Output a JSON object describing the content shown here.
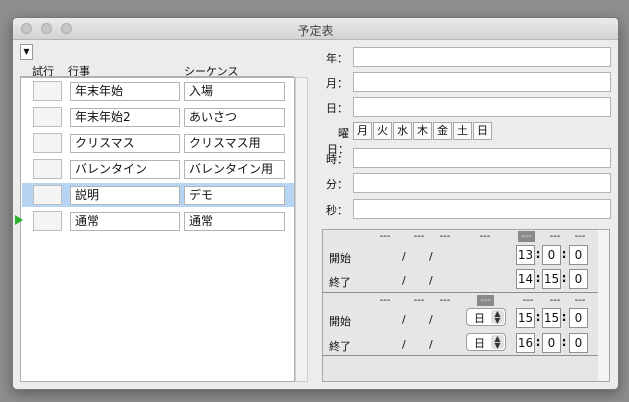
{
  "window": {
    "title": "予定表"
  },
  "list": {
    "menu_glyph": "▼",
    "headers": {
      "trial": "試行",
      "event": "行事",
      "sequence": "シーケンス"
    },
    "rows": [
      {
        "event": "年末年始",
        "sequence": "入場",
        "selected": false,
        "playing": false
      },
      {
        "event": "年末年始2",
        "sequence": "あいさつ",
        "selected": false,
        "playing": false
      },
      {
        "event": "クリスマス",
        "sequence": "クリスマス用",
        "selected": false,
        "playing": false
      },
      {
        "event": "バレンタイン",
        "sequence": "バレンタイン用",
        "selected": false,
        "playing": false
      },
      {
        "event": "説明",
        "sequence": "デモ",
        "selected": true,
        "playing": false
      },
      {
        "event": "通常",
        "sequence": "通常",
        "selected": false,
        "playing": true
      }
    ]
  },
  "form": {
    "year_label": "年：",
    "month_label": "月：",
    "day_label": "日：",
    "weekday_label": "曜日：",
    "hour_label": "時：",
    "minute_label": "分：",
    "second_label": "秒：",
    "weekdays": [
      "月",
      "火",
      "水",
      "木",
      "金",
      "土",
      "日"
    ],
    "year": "",
    "month": "",
    "day": "",
    "hour": "",
    "minute": "",
    "second": ""
  },
  "schedule": {
    "dash": "---",
    "slash": "/",
    "colon": ":",
    "block1": {
      "start_label": "開始",
      "end_label": "終了",
      "start_time": [
        "13",
        "0",
        "0"
      ],
      "end_time": [
        "14",
        "15",
        "0"
      ]
    },
    "block2": {
      "start_label": "開始",
      "end_label": "終了",
      "start_weekday": "日",
      "end_weekday": "日",
      "start_time": [
        "15",
        "15",
        "0"
      ],
      "end_time": [
        "16",
        "0",
        "0"
      ]
    }
  },
  "colors": {
    "selection": "#b6d4f3",
    "play_indicator": "#2bb12b"
  }
}
